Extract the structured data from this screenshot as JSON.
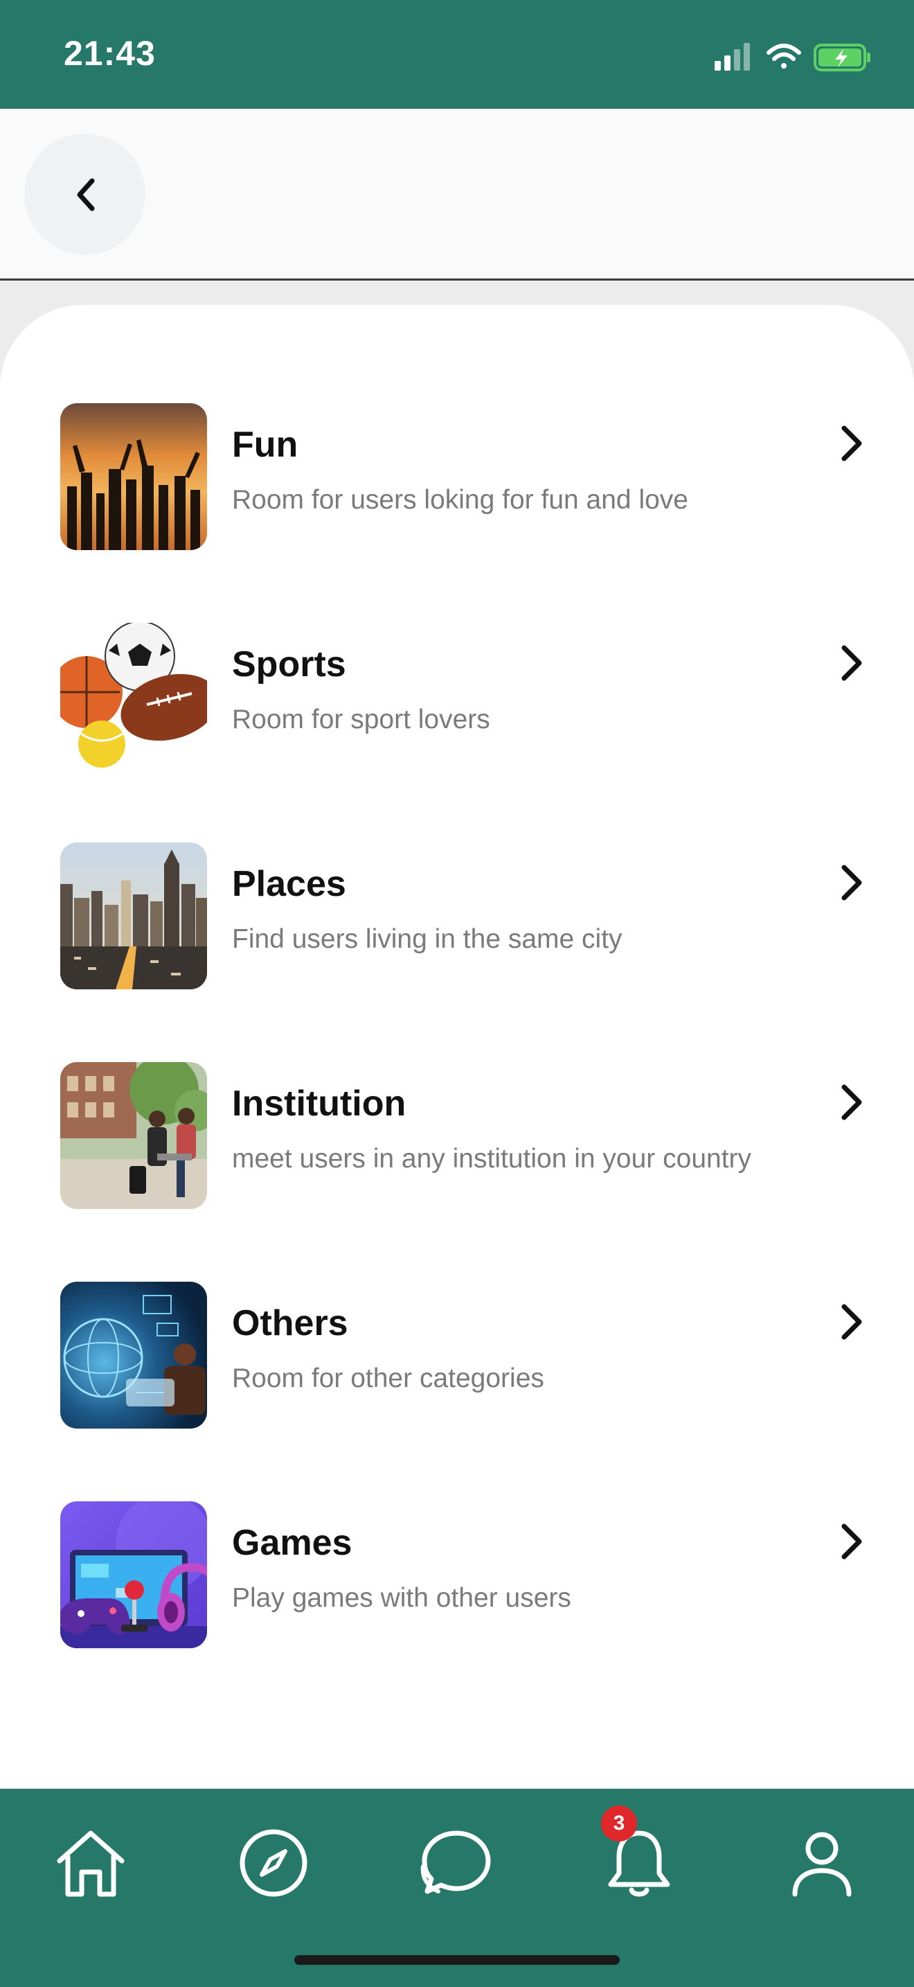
{
  "status_bar": {
    "time": "21:43"
  },
  "header": {
    "back_icon": "chevron-left-icon"
  },
  "categories": [
    {
      "title": "Fun",
      "subtitle": "Room for users loking for fun and love",
      "image": "party-crowd-sunset"
    },
    {
      "title": "Sports",
      "subtitle": "Room for sport lovers",
      "image": "sports-balls"
    },
    {
      "title": "Places",
      "subtitle": "Find users living in the same city",
      "image": "city-skyline"
    },
    {
      "title": "Institution",
      "subtitle": "meet users in any institution in your country",
      "image": "campus-students"
    },
    {
      "title": "Others",
      "subtitle": "Room for other categories",
      "image": "tech-globe"
    },
    {
      "title": "Games",
      "subtitle": "Play games with other users",
      "image": "gaming-setup"
    }
  ],
  "bottom_nav": {
    "items": [
      "home-icon",
      "compass-icon",
      "chat-icon",
      "bell-icon",
      "profile-icon"
    ],
    "notification_count": "3"
  },
  "colors": {
    "brand": "#267868",
    "badge": "#e0282c"
  }
}
